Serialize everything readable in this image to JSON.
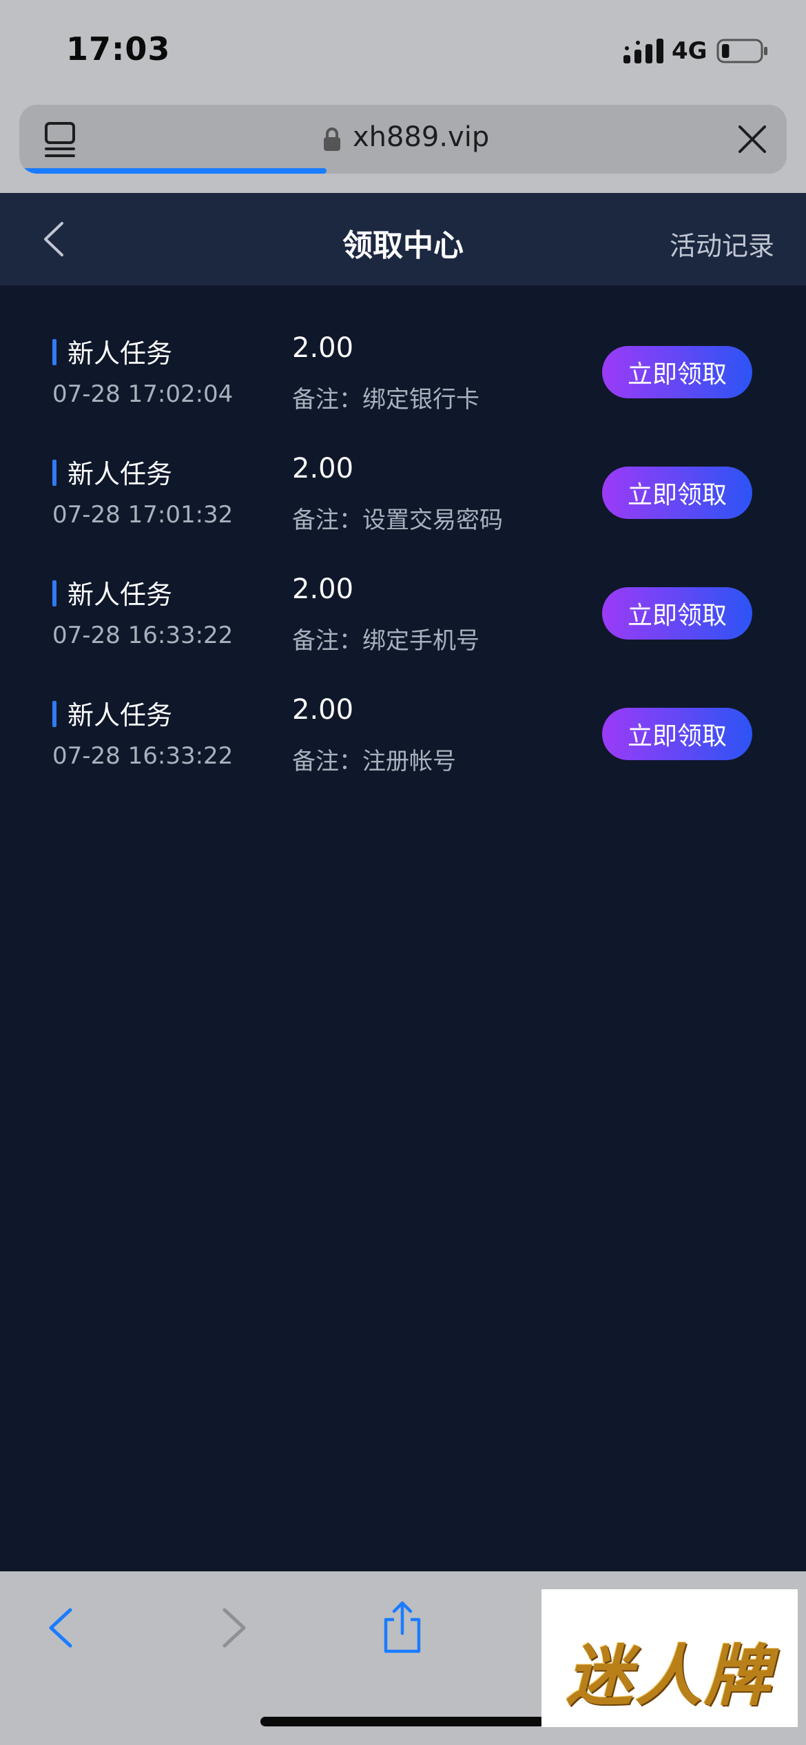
{
  "status_bar": {
    "time": "17:03",
    "network": "4G",
    "battery_level": 0.2
  },
  "browser": {
    "url": "xh889.vip",
    "load_progress": 0.4
  },
  "header": {
    "title": "领取中心",
    "records_label": "活动记录"
  },
  "tasks": [
    {
      "type": "新人任务",
      "time": "07-28 17:02:04",
      "amount": "2.00",
      "note": "备注：绑定银行卡",
      "button": "立即领取"
    },
    {
      "type": "新人任务",
      "time": "07-28 17:01:32",
      "amount": "2.00",
      "note": "备注：设置交易密码",
      "button": "立即领取"
    },
    {
      "type": "新人任务",
      "time": "07-28 16:33:22",
      "amount": "2.00",
      "note": "备注：绑定手机号",
      "button": "立即领取"
    },
    {
      "type": "新人任务",
      "time": "07-28 16:33:22",
      "amount": "2.00",
      "note": "备注：注册帐号",
      "button": "立即领取"
    }
  ],
  "watermark": {
    "text": "迷人牌"
  },
  "colors": {
    "page_bg": "#0f172a",
    "header_bg": "#1c2740",
    "accent_bar": "#2f7cf6",
    "button_gradient_start": "#9b3bf6",
    "button_gradient_end": "#2c54f5",
    "ios_blue": "#1a7cff"
  },
  "icons": [
    "signal-icon",
    "battery-icon",
    "tabs-icon",
    "lock-icon",
    "close-icon",
    "back-icon",
    "forward-icon",
    "share-icon"
  ]
}
